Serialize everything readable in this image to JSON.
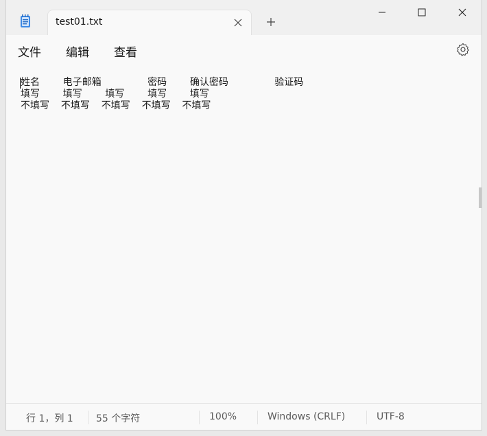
{
  "tab": {
    "title": "test01.txt"
  },
  "menu": {
    "file": "文件",
    "edit": "编辑",
    "view": "查看"
  },
  "editor": {
    "lines": [
      "姓名    电子邮箱        密码    确认密码        验证码",
      "填写    填写    填写    填写    填写",
      "不填写  不填写  不填写  不填写  不填写"
    ]
  },
  "status": {
    "position": "行 1，列 1",
    "chars": "55 个字符",
    "zoom": "100%",
    "line_ending": "Windows (CRLF)",
    "encoding": "UTF-8"
  },
  "icons": {
    "app": "notepad-icon",
    "tab_close": "close-icon",
    "new_tab": "plus-icon",
    "minimize": "minimize-icon",
    "maximize": "maximize-icon",
    "close": "close-icon",
    "settings": "gear-icon"
  },
  "colors": {
    "accent": "#1e6fd9",
    "background": "#f9f9f9"
  }
}
